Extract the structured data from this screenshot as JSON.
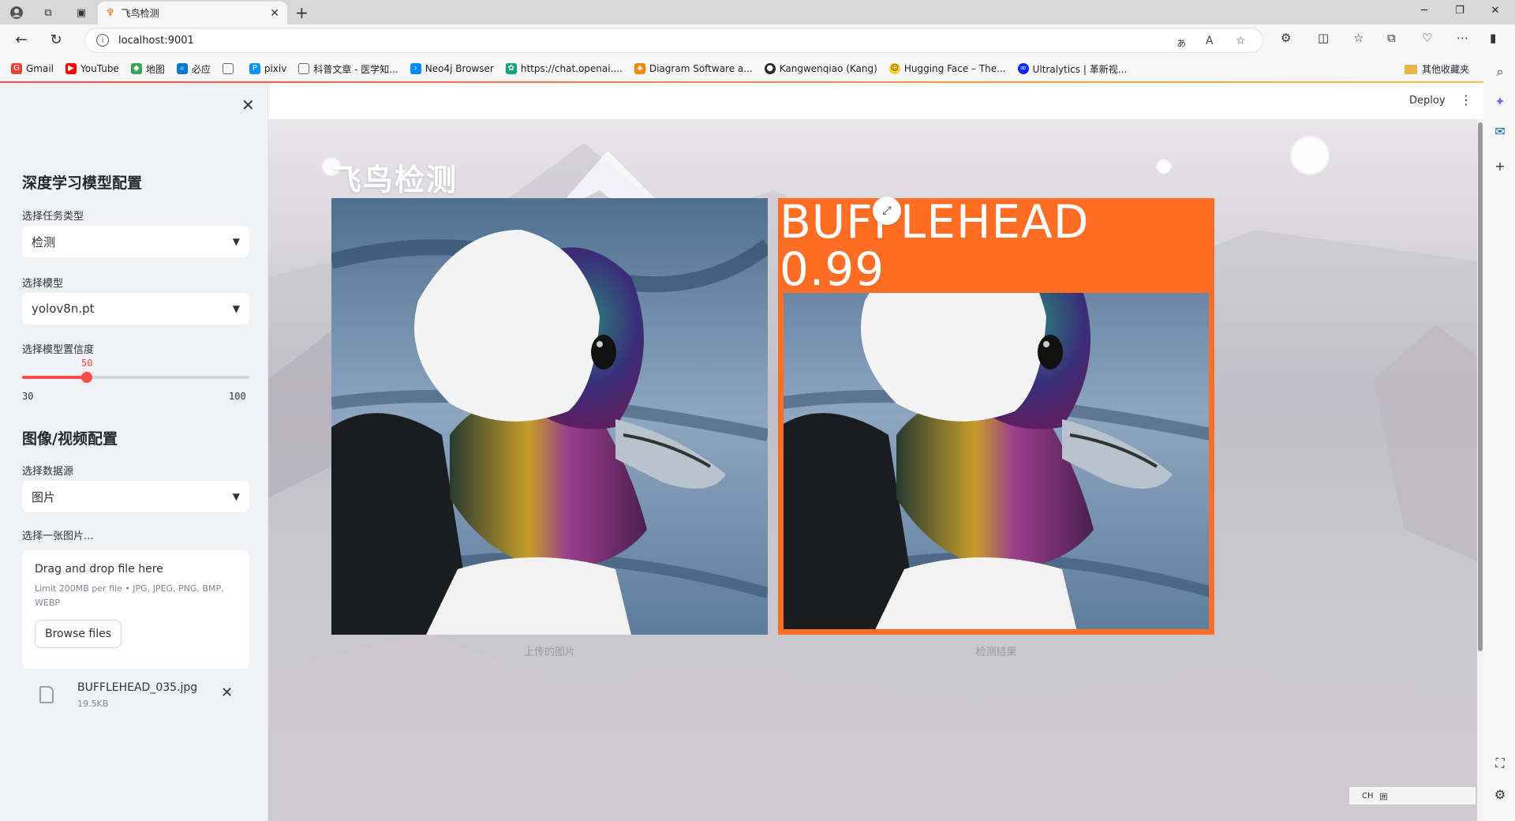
{
  "browser": {
    "tab_title": "飞鸟检测",
    "url": "localhost:9001",
    "bookmarks": [
      {
        "label": "Gmail",
        "color": "#ea4335"
      },
      {
        "label": "YouTube",
        "color": "#ff0000"
      },
      {
        "label": "地图",
        "color": "#34a853"
      },
      {
        "label": "必应",
        "color": "#0078d4"
      },
      {
        "label": "",
        "color": "#888888"
      },
      {
        "label": "pixiv",
        "color": "#0096fa"
      },
      {
        "label": "科普文章 - 医学知...",
        "color": "#888888"
      },
      {
        "label": "Neo4j Browser",
        "color": "#018bff"
      },
      {
        "label": "https://chat.openai....",
        "color": "#10a37f"
      },
      {
        "label": "Diagram Software a...",
        "color": "#f08705"
      },
      {
        "label": "Kangwenqiao (Kang)",
        "color": "#24292f"
      },
      {
        "label": "Hugging Face – The...",
        "color": "#ffd21e"
      },
      {
        "label": "Ultralytics | 革新视...",
        "color": "#042aff"
      }
    ],
    "other_bookmarks": "其他收藏夹"
  },
  "sidebar": {
    "section1_title": "深度学习模型配置",
    "task_label": "选择任务类型",
    "task_value": "检测",
    "model_label": "选择模型",
    "model_value": "yolov8n.pt",
    "conf_label": "选择模型置信度",
    "conf_value": 50,
    "conf_value_text": "50",
    "conf_min": "30",
    "conf_max": "100",
    "section2_title": "图像/视频配置",
    "source_label": "选择数据源",
    "source_value": "图片",
    "upload_label": "选择一张图片...",
    "dropzone_title": "Drag and drop file here",
    "dropzone_limit": "Limit 200MB per file • JPG, JPEG, PNG, BMP, WEBP",
    "browse_label": "Browse files",
    "file_name": "BUFFLEHEAD_035.jpg",
    "file_size": "19.5KB"
  },
  "header": {
    "deploy_label": "Deploy"
  },
  "main": {
    "title": "飞鸟检测",
    "caption_uploaded": "上传的图片",
    "caption_result": "检测结果",
    "detection_label": "BUFFLEHEAD 0.99",
    "detection_color": "#ff6e24"
  },
  "ime": {
    "lang": "CH",
    "grid": "囲"
  }
}
